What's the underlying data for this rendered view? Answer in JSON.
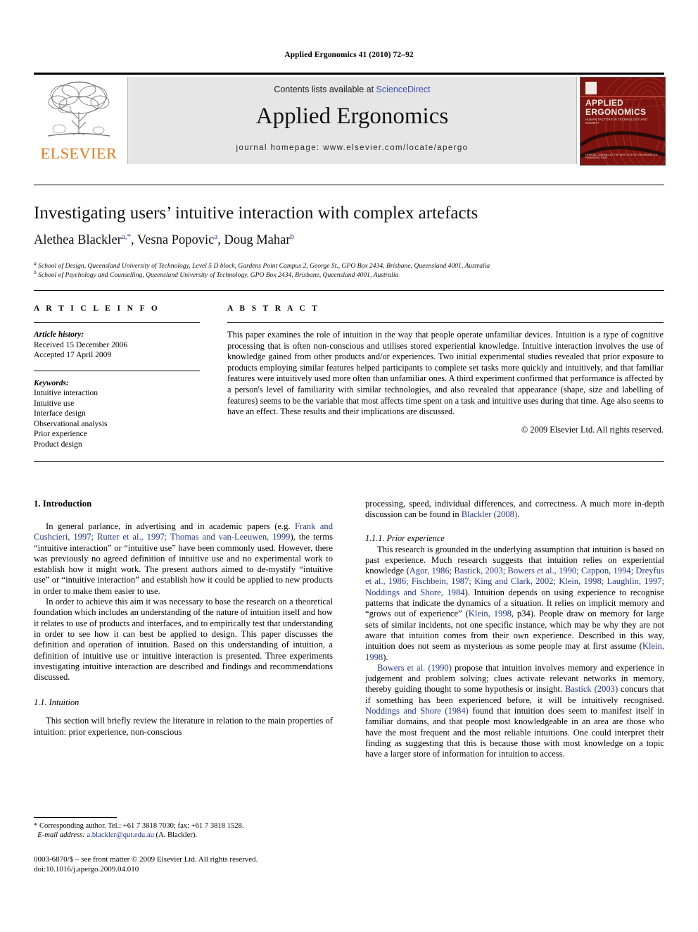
{
  "running_head": "Applied Ergonomics 41 (2010) 72–92",
  "masthead": {
    "contents_prefix": "Contents lists available at ",
    "sciencedirect": "ScienceDirect",
    "journal_name": "Applied Ergonomics",
    "homepage": "journal homepage: www.elsevier.com/locate/apergo",
    "publisher": "ELSEVIER",
    "cover": {
      "title": "APPLIED ERGONOMICS",
      "subtitle": "HUMAN FACTORS IN TECHNOLOGY AND SOCIETY",
      "footer": "OFFICIAL JOURNAL OF THE\nINSTITUTE OF ERGONOMICS & HUMAN FACTORS"
    }
  },
  "article": {
    "title": "Investigating users’ intuitive interaction with complex artefacts",
    "authors_html": "Alethea Blackler<sup>a,*</sup>, Vesna Popovic<sup>a</sup>, Doug Mahar<sup>b</sup>",
    "affiliation_a": "School of Design, Queensland University of Technology, Level 5 D block, Gardens Point Campus 2, George St., GPO Box 2434, Brisbane, Queensland 4001, Australia",
    "affiliation_b": "School of Psychology and Counselling, Queensland University of Technology, GPO Box 2434, Brisbane, Queensland 4001, Australia"
  },
  "article_info": {
    "heading": "A R T I C L E   I N F O",
    "history_label": "Article history:",
    "received": "Received 15 December 2006",
    "accepted": "Accepted 17 April 2009",
    "keywords_label": "Keywords:",
    "keywords": [
      "Intuitive interaction",
      "Intuitive use",
      "Interface design",
      "Observational analysis",
      "Prior experience",
      "Product design"
    ]
  },
  "abstract": {
    "heading": "A B S T R A C T",
    "text": "This paper examines the role of intuition in the way that people operate unfamiliar devices. Intuition is a type of cognitive processing that is often non-conscious and utilises stored experiential knowledge. Intuitive interaction involves the use of knowledge gained from other products and/or experiences. Two initial experimental studies revealed that prior exposure to products employing similar features helped participants to complete set tasks more quickly and intuitively, and that familiar features were intuitively used more often than unfamiliar ones. A third experiment confirmed that performance is affected by a person's level of familiarity with similar technologies, and also revealed that appearance (shape, size and labelling of features) seems to be the variable that most affects time spent on a task and intuitive uses during that time. Age also seems to have an effect. These results and their implications are discussed.",
    "copyright": "© 2009 Elsevier Ltd. All rights reserved."
  },
  "body": {
    "intro_heading": "1. Introduction",
    "intro_p1_a": "In general parlance, in advertising and in academic papers (e.g. ",
    "intro_p1_ref1": "Frank and Cushcieri, 1997; Rutter et al., 1997; Thomas and van-Leeuwen, 1999",
    "intro_p1_b": "), the terms “intuitive interaction” or “intuitive use” have been commonly used. However, there was previously no agreed definition of intuitive use and no experimental work to establish how it might work. The present authors aimed to de-mystify “intuitive use” or “intuitive interaction” and establish how it could be applied to new products in order to make them easier to use.",
    "intro_p2": "In order to achieve this aim it was necessary to base the research on a theoretical foundation which includes an understanding of the nature of intuition itself and how it relates to use of products and interfaces, and to empirically test that understanding in order to see how it can best be applied to design. This paper discusses the definition and operation of intuition. Based on this understanding of intuition, a definition of intuitive use or intuitive interaction is presented. Three experiments investigating intuitive interaction are described and findings and recommendations discussed.",
    "intuition_heading": "1.1. Intuition",
    "intuition_p1": "This section will briefly review the literature in relation to the main properties of intuition: prior experience, non-conscious",
    "right_cont_a": "processing, speed, individual differences, and correctness. A much more in-depth discussion can be found in ",
    "right_cont_ref": "Blackler (2008)",
    "right_cont_b": ".",
    "prior_exp_heading": "1.1.1. Prior experience",
    "prior_p1_a": "This research is grounded in the underlying assumption that intuition is based on past experience. Much research suggests that intuition relies on experiential knowledge (",
    "prior_p1_ref1": "Agor, 1986; Bastick, 2003; Bowers et al., 1990; Cappon, 1994; Dreyfus et al., 1986; Fischbein, 1987; King and Clark, 2002; Klein, 1998; Laughlin, 1997; Noddings and Shore, 1984",
    "prior_p1_b": "). Intuition depends on using experience to recognise patterns that indicate the dynamics of a situation. It relies on implicit memory and “grows out of experience” (",
    "prior_p1_ref2": "Klein, 1998",
    "prior_p1_c": ", p34). People draw on memory for large sets of similar incidents, not one specific instance, which may be why they are not aware that intuition comes from their own experience. Described in this way, intuition does not seem as mysterious as some people may at first assume (",
    "prior_p1_ref3": "Klein, 1998",
    "prior_p1_d": ").",
    "prior_p2_ref1": "Bowers et al. (1990)",
    "prior_p2_a": " propose that intuition involves memory and experience in judgement and problem solving; clues activate relevant networks in memory, thereby guiding thought to some hypothesis or insight. ",
    "prior_p2_ref2": "Bastick (2003)",
    "prior_p2_b": " concurs that if something has been experienced before, it will be intuitively recognised. ",
    "prior_p2_ref3": "Noddings and Shore (1984)",
    "prior_p2_c": " found that intuition does seem to manifest itself in familiar domains, and that people most knowledgeable in an area are those who have the most frequent and the most reliable intuitions. One could interpret their finding as suggesting that this is because those with most knowledge on a topic have a larger store of information for intuition to access."
  },
  "footnotes": {
    "corresponding": "* Corresponding author. Tel.: +61 7 3818 7030; fax: +61 7 3818 1528.",
    "email_label": "E-mail address:",
    "email": "a.blackler@qut.edu.au",
    "email_suffix": " (A. Blackler).",
    "imprint_line1": "0003-6870/$ – see front matter © 2009 Elsevier Ltd. All rights reserved.",
    "imprint_line2": "doi:10.1016/j.apergo.2009.04.010"
  }
}
